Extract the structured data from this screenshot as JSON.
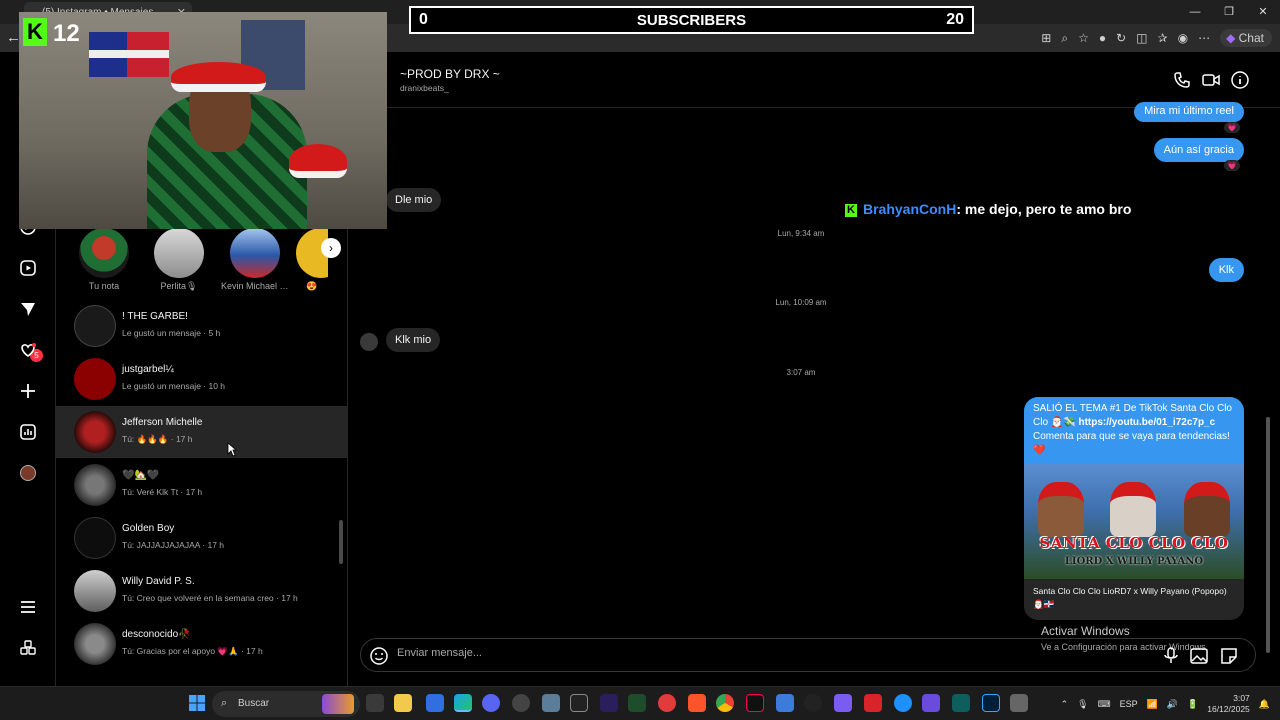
{
  "browser": {
    "tab_title": "(5) Instagram • Mensajes",
    "window_controls": [
      "—",
      "❐",
      "✕"
    ],
    "chat_button_label": "Chat"
  },
  "overlay": {
    "subscribers_left": "0",
    "subscribers_title": "SUBSCRIBERS",
    "subscribers_right": "20",
    "kick_count": "12"
  },
  "rail": {
    "notifications_badge": "5"
  },
  "notes": [
    {
      "label": "Tu nota"
    },
    {
      "label": "Perlita🎙"
    },
    {
      "label": "Kevin Michael M..."
    },
    {
      "label": "😍"
    }
  ],
  "conversations": [
    {
      "name": "! THE GARBE!",
      "preview": "Le gustó un mensaje · 5 h",
      "avatar_color": "#1a1a1a"
    },
    {
      "name": "justgarbel¼",
      "preview": "Le gustó un mensaje · 10 h",
      "avatar_color": "#8b0000"
    },
    {
      "name": "Jefferson Michelle",
      "preview": "Tú: 🔥🔥🔥 · 17 h",
      "avatar_color": "#5a1a1a"
    },
    {
      "name": "🖤🏡🖤",
      "preview": "Tú: Veré Klk Tt · 17 h",
      "avatar_color": "#3c3c3c"
    },
    {
      "name": "Golden Boy",
      "preview": "Tú: JAJJAJJAJAJAA · 17 h",
      "avatar_color": "#0d0d0d"
    },
    {
      "name": "Willy David P. S.",
      "preview": "Tú: Creo que volveré en la semana creo · 17 h",
      "avatar_color": "#6b6b6b"
    },
    {
      "name": "desconocido🥀",
      "preview": "Tú: Gracias por el apoyo 💗🙏 · 17 h",
      "avatar_color": "#4a4a4a"
    }
  ],
  "chat": {
    "name": "~PROD BY DRX ~",
    "username": "dranixbeats_",
    "messages": {
      "m1": "Mira mi último reel",
      "m2": "Aún así gracia",
      "m3": "Dle mio",
      "m4": "Klk",
      "m5": "Klk mio"
    },
    "heart": "💗",
    "timestamps": [
      "Lun, 9:34 am",
      "Lun, 10:09 am",
      "3:07 am"
    ],
    "kick_user": "BrahyanConH",
    "kick_text": ": me dejo, pero te amo bro",
    "share": {
      "text_before": "SALIÓ EL TEMA #1 De TikTok Santa Clo Clo Clo 🎅🏻💸",
      "link": "https://youtu.be/01_i72c7p_c",
      "text_after": " Comenta para que se vaya para tendencias!❤️",
      "image_title": "SANTA CLO CLO CLO",
      "image_subtitle": "LIORD X WILLY PAYANO",
      "caption": "Santa Clo Clo Clo LioRD7 x Willy Payano (Popopo) 🎅🏻🇩🇴"
    },
    "placeholder": "Enviar mensaje..."
  },
  "watermark": {
    "title": "Activar Windows",
    "subtitle": "Ve a Configuración para activar Windows."
  },
  "taskbar": {
    "search_label": "Buscar",
    "lang": "ESP",
    "time": "3:07",
    "date": "16/12/2025"
  },
  "colors": {
    "accent_blue": "#3797f0",
    "kick_green": "#53fc18",
    "badge_red": "#ff3040"
  }
}
